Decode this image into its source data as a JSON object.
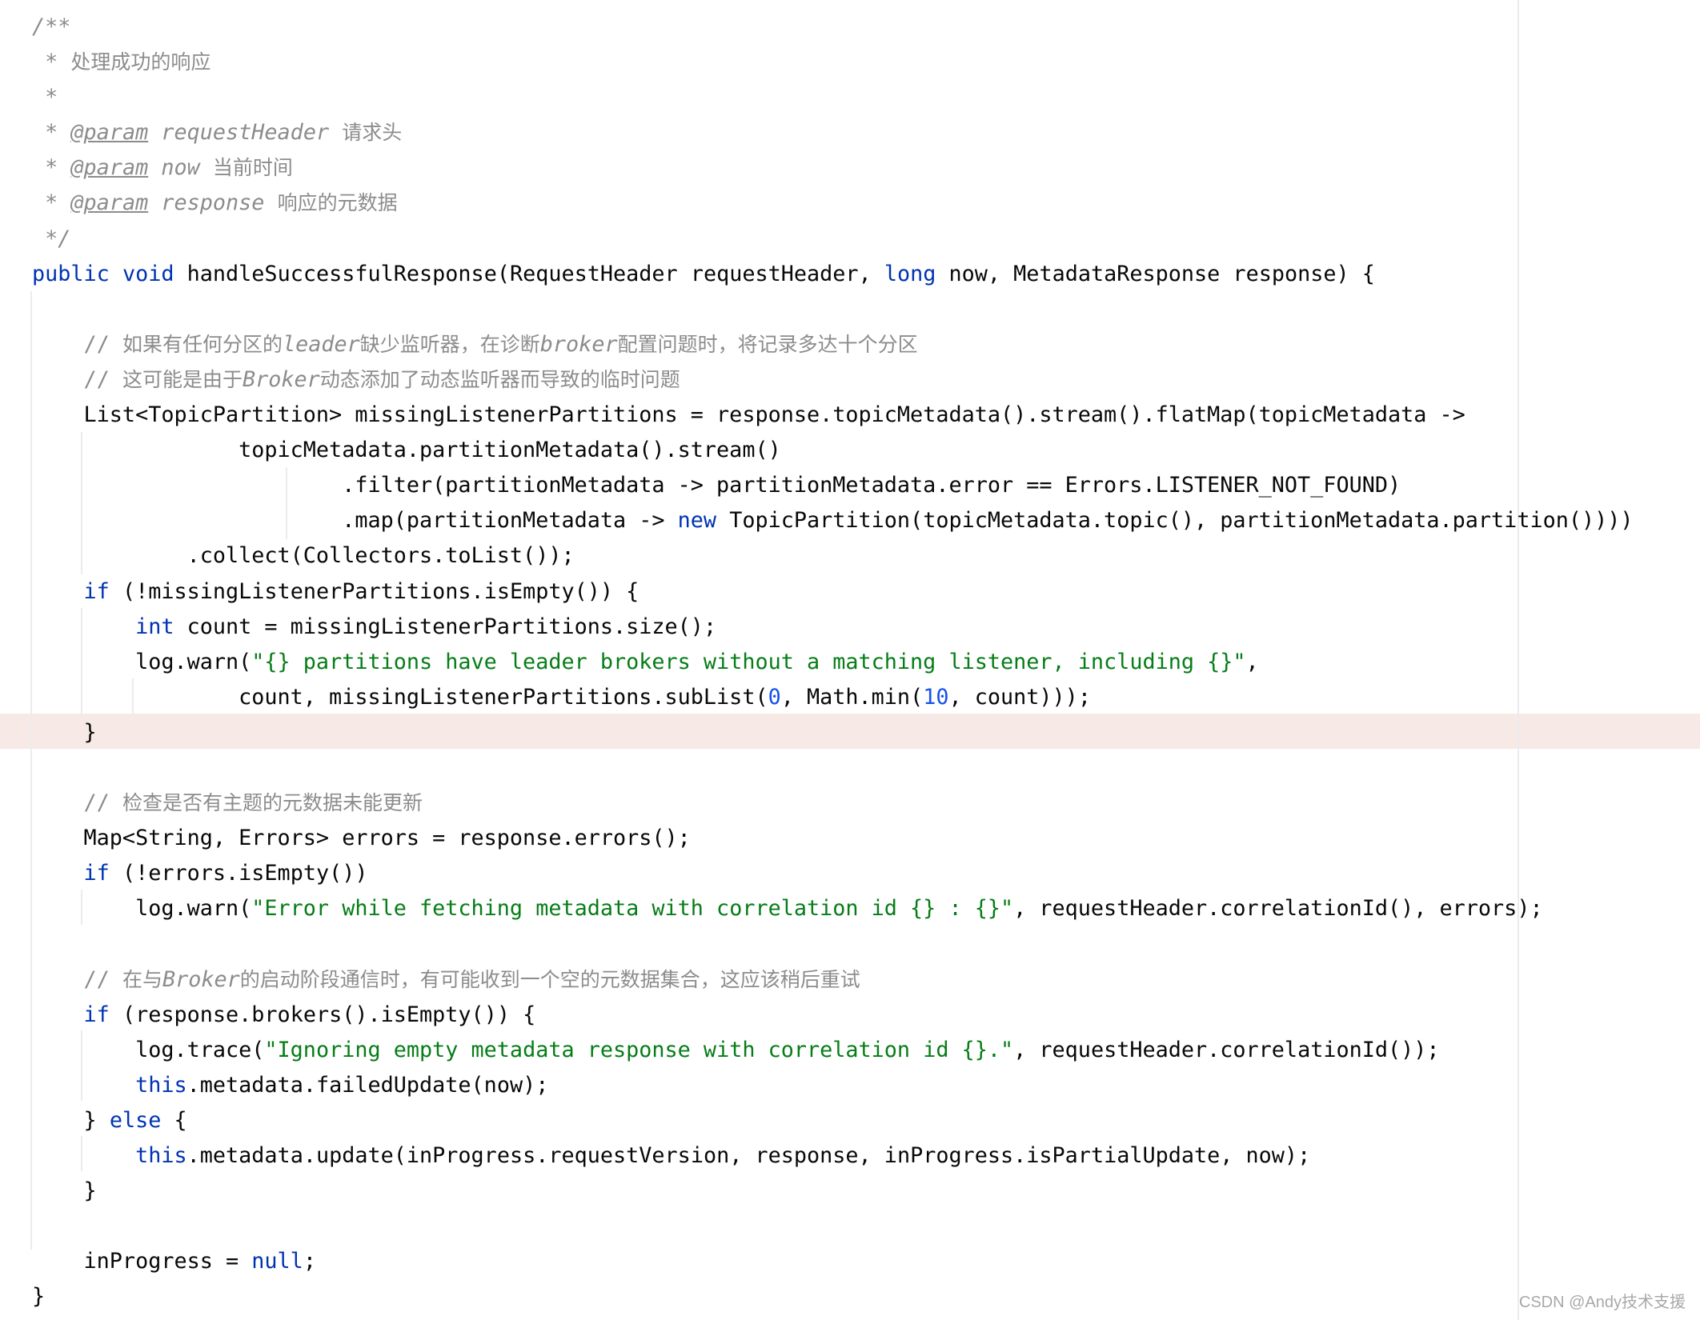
{
  "editor": {
    "language": "java",
    "highlighted_line": 21,
    "colors": {
      "keyword": "#0033b3",
      "string": "#067d17",
      "number": "#1750eb",
      "comment": "#8c8c8c",
      "text": "#080808",
      "highlight_bg": "#f7e9e6"
    },
    "lines": [
      [
        {
          "t": "/**",
          "c": "cm"
        }
      ],
      [
        {
          "t": " * ",
          "c": "cm"
        },
        {
          "t": "处理成功的响应",
          "c": "cm cjk"
        }
      ],
      [
        {
          "t": " *",
          "c": "cm"
        }
      ],
      [
        {
          "t": " * ",
          "c": "cm"
        },
        {
          "t": "@param",
          "c": "tag"
        },
        {
          "t": " requestHeader ",
          "c": "cm"
        },
        {
          "t": "请求头",
          "c": "cm cjk"
        }
      ],
      [
        {
          "t": " * ",
          "c": "cm"
        },
        {
          "t": "@param",
          "c": "tag"
        },
        {
          "t": " now ",
          "c": "cm"
        },
        {
          "t": "当前时间",
          "c": "cm cjk"
        }
      ],
      [
        {
          "t": " * ",
          "c": "cm"
        },
        {
          "t": "@param",
          "c": "tag"
        },
        {
          "t": " response ",
          "c": "cm"
        },
        {
          "t": "响应的元数据",
          "c": "cm cjk"
        }
      ],
      [
        {
          "t": " */",
          "c": "cm"
        }
      ],
      [
        {
          "t": "public",
          "c": "kw"
        },
        {
          "t": " "
        },
        {
          "t": "void",
          "c": "kw"
        },
        {
          "t": " handleSuccessfulResponse(RequestHeader requestHeader, "
        },
        {
          "t": "long",
          "c": "kw"
        },
        {
          "t": " now, MetadataResponse response) {"
        }
      ],
      [],
      [
        {
          "t": "    // ",
          "c": "cmz"
        },
        {
          "t": "如果有任何分区的",
          "c": "cmz cjk"
        },
        {
          "t": "leader",
          "c": "cm"
        },
        {
          "t": "缺少监听器，在诊断",
          "c": "cmz cjk"
        },
        {
          "t": "broker",
          "c": "cm"
        },
        {
          "t": "配置问题时，将记录多达十个分区",
          "c": "cmz cjk"
        }
      ],
      [
        {
          "t": "    // ",
          "c": "cmz"
        },
        {
          "t": "这可能是由于",
          "c": "cmz cjk"
        },
        {
          "t": "Broker",
          "c": "cm"
        },
        {
          "t": "动态添加了动态监听器而导致的临时问题",
          "c": "cmz cjk"
        }
      ],
      [
        {
          "t": "    List<TopicPartition> missingListenerPartitions = response.topicMetadata().stream().flatMap(topicMetadata ->"
        }
      ],
      [
        {
          "t": "                topicMetadata.partitionMetadata().stream()"
        }
      ],
      [
        {
          "t": "                        .filter(partitionMetadata -> partitionMetadata.error == Errors.LISTENER_NOT_FOUND)"
        }
      ],
      [
        {
          "t": "                        .map(partitionMetadata -> "
        },
        {
          "t": "new",
          "c": "kw"
        },
        {
          "t": " TopicPartition(topicMetadata.topic(), partitionMetadata.partition())))"
        }
      ],
      [
        {
          "t": "            .collect(Collectors.toList());"
        }
      ],
      [
        {
          "t": "    "
        },
        {
          "t": "if",
          "c": "kw"
        },
        {
          "t": " (!missingListenerPartitions.isEmpty()) {"
        }
      ],
      [
        {
          "t": "        "
        },
        {
          "t": "int",
          "c": "kw"
        },
        {
          "t": " count = missingListenerPartitions.size();"
        }
      ],
      [
        {
          "t": "        log.warn("
        },
        {
          "t": "\"{} partitions have leader brokers without a matching listener, including {}\"",
          "c": "str"
        },
        {
          "t": ","
        }
      ],
      [
        {
          "t": "                count, missingListenerPartitions.subList("
        },
        {
          "t": "0",
          "c": "num"
        },
        {
          "t": ", Math.min("
        },
        {
          "t": "10",
          "c": "num"
        },
        {
          "t": ", count)));"
        }
      ],
      [
        {
          "t": "    }"
        }
      ],
      [],
      [
        {
          "t": "    // ",
          "c": "cmz"
        },
        {
          "t": "检查是否有主题的元数据未能更新",
          "c": "cmz cjk"
        }
      ],
      [
        {
          "t": "    Map<String, Errors> errors = response.errors();"
        }
      ],
      [
        {
          "t": "    "
        },
        {
          "t": "if",
          "c": "kw"
        },
        {
          "t": " (!errors.isEmpty())"
        }
      ],
      [
        {
          "t": "        log.warn("
        },
        {
          "t": "\"Error while fetching metadata with correlation id {} : {}\"",
          "c": "str"
        },
        {
          "t": ", requestHeader.correlationId(), errors);"
        }
      ],
      [],
      [
        {
          "t": "    // ",
          "c": "cmz"
        },
        {
          "t": "在与",
          "c": "cmz cjk"
        },
        {
          "t": "Broker",
          "c": "cm"
        },
        {
          "t": "的启动阶段通信时，有可能收到一个空的元数据集合，这应该稍后重试",
          "c": "cmz cjk"
        }
      ],
      [
        {
          "t": "    "
        },
        {
          "t": "if",
          "c": "kw"
        },
        {
          "t": " (response.brokers().isEmpty()) {"
        }
      ],
      [
        {
          "t": "        log.trace("
        },
        {
          "t": "\"Ignoring empty metadata response with correlation id {}.\"",
          "c": "str"
        },
        {
          "t": ", requestHeader.correlationId());"
        }
      ],
      [
        {
          "t": "        "
        },
        {
          "t": "this",
          "c": "kw"
        },
        {
          "t": ".metadata.failedUpdate(now);"
        }
      ],
      [
        {
          "t": "    } "
        },
        {
          "t": "else",
          "c": "kw"
        },
        {
          "t": " {"
        }
      ],
      [
        {
          "t": "        "
        },
        {
          "t": "this",
          "c": "kw"
        },
        {
          "t": ".metadata.update(inProgress.requestVersion, response, inProgress.isPartialUpdate, now);"
        }
      ],
      [
        {
          "t": "    }"
        }
      ],
      [],
      [
        {
          "t": "    inProgress = "
        },
        {
          "t": "null",
          "c": "kw"
        },
        {
          "t": ";"
        }
      ],
      [
        {
          "t": "}"
        }
      ]
    ]
  },
  "watermark": {
    "text": "CSDN @Andy技术支援"
  }
}
